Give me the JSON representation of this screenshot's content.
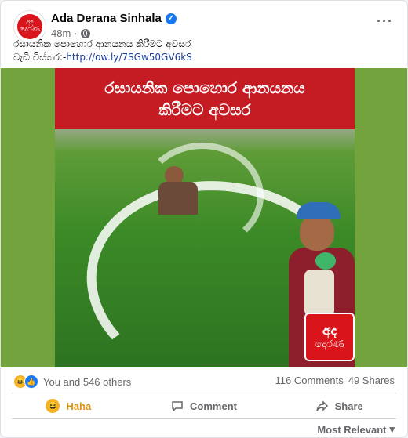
{
  "post": {
    "page_name": "Ada Derana Sinhala",
    "time": "48m",
    "text_line1": "රසායනික පොහොර ආනයනය කිරීමට අවසර",
    "text_line2_prefix": "වැඩි විස්තර:-",
    "link": "http://ow.ly/7SGw50GV6kS",
    "avatar_text_top": "අද",
    "avatar_text_bottom": "දෙරණ"
  },
  "image": {
    "banner_line1": "රසායනික පොහොර ආනයනය",
    "banner_line2": "කිරීමට අවසර",
    "logo_line1": "අද",
    "logo_line2": "දෙරණ"
  },
  "engagement": {
    "reactions_text": "You and 546 others",
    "comments": "116 Comments",
    "shares": "49 Shares"
  },
  "actions": {
    "haha": "Haha",
    "comment": "Comment",
    "share": "Share"
  },
  "sort": {
    "label": "Most Relevant"
  },
  "colors": {
    "accent_red": "#c41c22",
    "link_blue": "#1c3e9e",
    "haha_yellow": "#f7b125"
  }
}
